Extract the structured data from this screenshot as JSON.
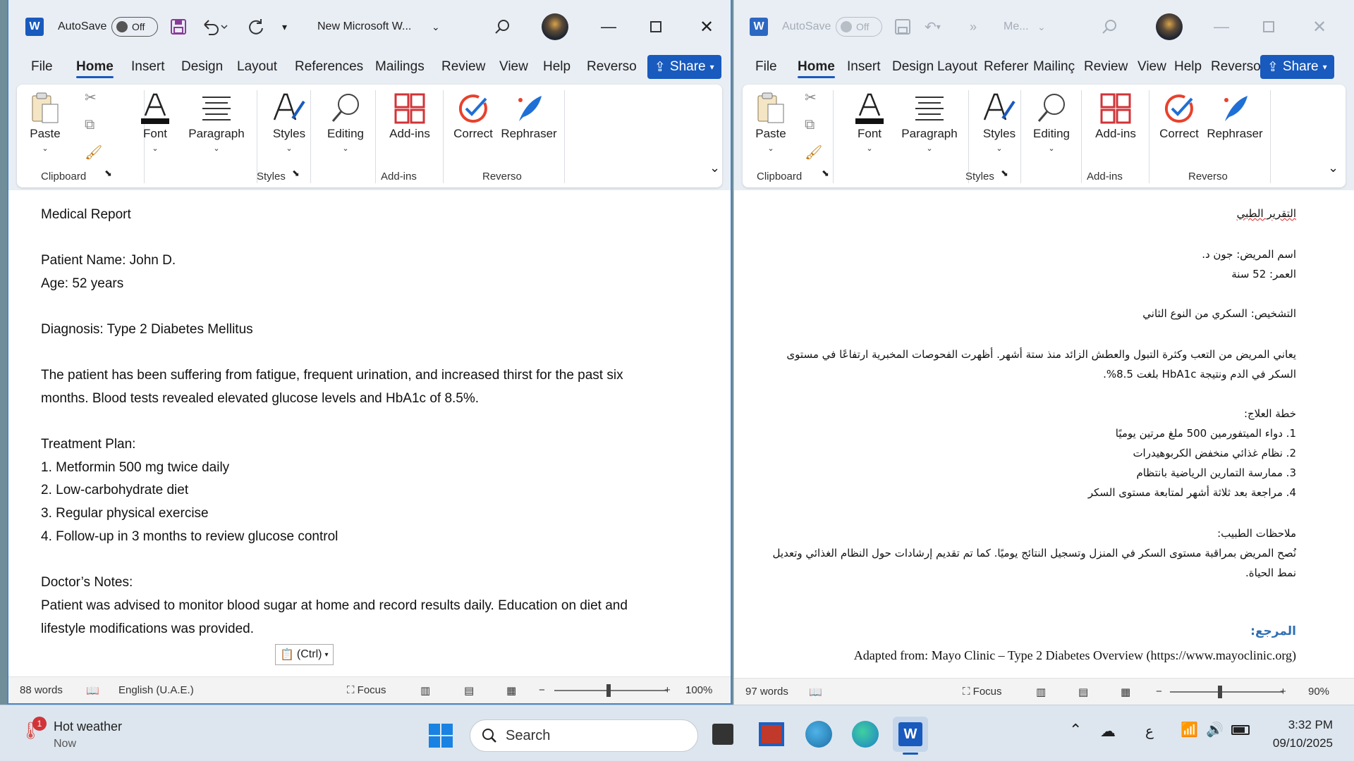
{
  "left": {
    "autosave_label": "AutoSave",
    "toggle_state": "Off",
    "doc_title": "New Microsoft W...",
    "menu": [
      "File",
      "Home",
      "Insert",
      "Design",
      "Layout",
      "References",
      "Mailings",
      "Review",
      "View",
      "Help",
      "Reverso"
    ],
    "share": "Share",
    "ribbon": {
      "paste": "Paste",
      "font": "Font",
      "paragraph": "Paragraph",
      "styles": "Styles",
      "editing": "Editing",
      "addins": "Add-ins",
      "correct": "Correct",
      "rephraser": "Rephraser",
      "group_clipboard": "Clipboard",
      "group_styles": "Styles",
      "group_addins": "Add-ins",
      "group_reverso": "Reverso"
    },
    "doc_lines": [
      "Medical Report",
      "",
      "Patient Name: John D.",
      "Age: 52 years",
      "",
      "Diagnosis: Type 2 Diabetes Mellitus",
      "",
      "The patient has been suffering from fatigue, frequent urination, and increased thirst for the past six",
      "months. Blood tests revealed elevated glucose levels and HbA1c of 8.5%.",
      "",
      "Treatment Plan:",
      "1. Metformin 500 mg twice daily",
      "2. Low-carbohydrate diet",
      "3. Regular physical exercise",
      "4. Follow-up in 3 months to review glucose control",
      "",
      "Doctor’s Notes:",
      "Patient was advised to monitor blood sugar at home and record results daily. Education on diet and",
      "lifestyle modifications was provided."
    ],
    "paste_options": "(Ctrl)",
    "status": {
      "words": "88 words",
      "language": "English (U.A.E.)",
      "focus": "Focus",
      "zoom": "100%"
    }
  },
  "right": {
    "autosave_label": "AutoSave",
    "toggle_state": "Off",
    "doc_title": "Me...",
    "menu": [
      "File",
      "Home",
      "Insert",
      "Design",
      "Layout",
      "Referer",
      "Mailinç",
      "Review",
      "View",
      "Help",
      "Reverso"
    ],
    "share": "Share",
    "ribbon": {
      "paste": "Paste",
      "font": "Font",
      "paragraph": "Paragraph",
      "styles": "Styles",
      "editing": "Editing",
      "addins": "Add-ins",
      "correct": "Correct",
      "rephraser": "Rephraser",
      "group_clipboard": "Clipboard",
      "group_styles": "Styles",
      "group_addins": "Add-ins",
      "group_reverso": "Reverso"
    },
    "doc_lines": [
      "التقرير الطبي",
      "",
      "اسم المريض: جون د.",
      "العمر: 52 سنة",
      "",
      "التشخيص: السكري من النوع الثاني",
      "",
      "يعاني المريض من التعب وكثرة التبول والعطش الزائد منذ ستة أشهر. أظهرت الفحوصات المخبرية ارتفاعًا في مستوى",
      "السكر في الدم ونتيجة HbA1c بلغت 8.5%.",
      "",
      "خطة العلاج:",
      "1. دواء الميتفورمين 500 ملغ مرتين يوميًا",
      "2. نظام غذائي منخفض الكربوهيدرات",
      "3. ممارسة التمارين الرياضية بانتظام",
      "4. مراجعة بعد ثلاثة أشهر لمتابعة مستوى السكر",
      "",
      "ملاحظات الطبيب:",
      "نُصح المريض بمراقبة مستوى السكر في المنزل وتسجيل النتائج يوميًا. كما تم تقديم إرشادات حول النظام الغذائي وتعديل",
      "نمط الحياة."
    ],
    "reference_heading": "المرجع:",
    "reference": "Adapted from: Mayo Clinic – Type 2 Diabetes Overview (https://www.mayoclinic.org)",
    "status": {
      "words": "97 words",
      "focus": "Focus",
      "zoom": "90%"
    }
  },
  "taskbar": {
    "weather_title": "Hot weather",
    "weather_sub": "Now",
    "weather_badge": "1",
    "search": "Search",
    "ime": "ع",
    "time": "3:32 PM",
    "date": "09/10/2025"
  },
  "colors": {
    "word_blue": "#185abd",
    "titlebar": "#e9eef5",
    "taskbar": "#dde6ef"
  }
}
